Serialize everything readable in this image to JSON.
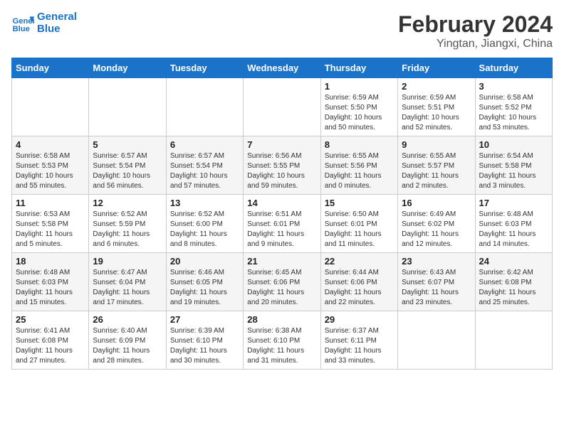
{
  "header": {
    "logo_line1": "General",
    "logo_line2": "Blue",
    "title": "February 2024",
    "subtitle": "Yingtan, Jiangxi, China"
  },
  "weekdays": [
    "Sunday",
    "Monday",
    "Tuesday",
    "Wednesday",
    "Thursday",
    "Friday",
    "Saturday"
  ],
  "weeks": [
    [
      {
        "day": "",
        "sunrise": "",
        "sunset": "",
        "daylight": ""
      },
      {
        "day": "",
        "sunrise": "",
        "sunset": "",
        "daylight": ""
      },
      {
        "day": "",
        "sunrise": "",
        "sunset": "",
        "daylight": ""
      },
      {
        "day": "",
        "sunrise": "",
        "sunset": "",
        "daylight": ""
      },
      {
        "day": "1",
        "sunrise": "Sunrise: 6:59 AM",
        "sunset": "Sunset: 5:50 PM",
        "daylight": "Daylight: 10 hours and 50 minutes."
      },
      {
        "day": "2",
        "sunrise": "Sunrise: 6:59 AM",
        "sunset": "Sunset: 5:51 PM",
        "daylight": "Daylight: 10 hours and 52 minutes."
      },
      {
        "day": "3",
        "sunrise": "Sunrise: 6:58 AM",
        "sunset": "Sunset: 5:52 PM",
        "daylight": "Daylight: 10 hours and 53 minutes."
      }
    ],
    [
      {
        "day": "4",
        "sunrise": "Sunrise: 6:58 AM",
        "sunset": "Sunset: 5:53 PM",
        "daylight": "Daylight: 10 hours and 55 minutes."
      },
      {
        "day": "5",
        "sunrise": "Sunrise: 6:57 AM",
        "sunset": "Sunset: 5:54 PM",
        "daylight": "Daylight: 10 hours and 56 minutes."
      },
      {
        "day": "6",
        "sunrise": "Sunrise: 6:57 AM",
        "sunset": "Sunset: 5:54 PM",
        "daylight": "Daylight: 10 hours and 57 minutes."
      },
      {
        "day": "7",
        "sunrise": "Sunrise: 6:56 AM",
        "sunset": "Sunset: 5:55 PM",
        "daylight": "Daylight: 10 hours and 59 minutes."
      },
      {
        "day": "8",
        "sunrise": "Sunrise: 6:55 AM",
        "sunset": "Sunset: 5:56 PM",
        "daylight": "Daylight: 11 hours and 0 minutes."
      },
      {
        "day": "9",
        "sunrise": "Sunrise: 6:55 AM",
        "sunset": "Sunset: 5:57 PM",
        "daylight": "Daylight: 11 hours and 2 minutes."
      },
      {
        "day": "10",
        "sunrise": "Sunrise: 6:54 AM",
        "sunset": "Sunset: 5:58 PM",
        "daylight": "Daylight: 11 hours and 3 minutes."
      }
    ],
    [
      {
        "day": "11",
        "sunrise": "Sunrise: 6:53 AM",
        "sunset": "Sunset: 5:58 PM",
        "daylight": "Daylight: 11 hours and 5 minutes."
      },
      {
        "day": "12",
        "sunrise": "Sunrise: 6:52 AM",
        "sunset": "Sunset: 5:59 PM",
        "daylight": "Daylight: 11 hours and 6 minutes."
      },
      {
        "day": "13",
        "sunrise": "Sunrise: 6:52 AM",
        "sunset": "Sunset: 6:00 PM",
        "daylight": "Daylight: 11 hours and 8 minutes."
      },
      {
        "day": "14",
        "sunrise": "Sunrise: 6:51 AM",
        "sunset": "Sunset: 6:01 PM",
        "daylight": "Daylight: 11 hours and 9 minutes."
      },
      {
        "day": "15",
        "sunrise": "Sunrise: 6:50 AM",
        "sunset": "Sunset: 6:01 PM",
        "daylight": "Daylight: 11 hours and 11 minutes."
      },
      {
        "day": "16",
        "sunrise": "Sunrise: 6:49 AM",
        "sunset": "Sunset: 6:02 PM",
        "daylight": "Daylight: 11 hours and 12 minutes."
      },
      {
        "day": "17",
        "sunrise": "Sunrise: 6:48 AM",
        "sunset": "Sunset: 6:03 PM",
        "daylight": "Daylight: 11 hours and 14 minutes."
      }
    ],
    [
      {
        "day": "18",
        "sunrise": "Sunrise: 6:48 AM",
        "sunset": "Sunset: 6:03 PM",
        "daylight": "Daylight: 11 hours and 15 minutes."
      },
      {
        "day": "19",
        "sunrise": "Sunrise: 6:47 AM",
        "sunset": "Sunset: 6:04 PM",
        "daylight": "Daylight: 11 hours and 17 minutes."
      },
      {
        "day": "20",
        "sunrise": "Sunrise: 6:46 AM",
        "sunset": "Sunset: 6:05 PM",
        "daylight": "Daylight: 11 hours and 19 minutes."
      },
      {
        "day": "21",
        "sunrise": "Sunrise: 6:45 AM",
        "sunset": "Sunset: 6:06 PM",
        "daylight": "Daylight: 11 hours and 20 minutes."
      },
      {
        "day": "22",
        "sunrise": "Sunrise: 6:44 AM",
        "sunset": "Sunset: 6:06 PM",
        "daylight": "Daylight: 11 hours and 22 minutes."
      },
      {
        "day": "23",
        "sunrise": "Sunrise: 6:43 AM",
        "sunset": "Sunset: 6:07 PM",
        "daylight": "Daylight: 11 hours and 23 minutes."
      },
      {
        "day": "24",
        "sunrise": "Sunrise: 6:42 AM",
        "sunset": "Sunset: 6:08 PM",
        "daylight": "Daylight: 11 hours and 25 minutes."
      }
    ],
    [
      {
        "day": "25",
        "sunrise": "Sunrise: 6:41 AM",
        "sunset": "Sunset: 6:08 PM",
        "daylight": "Daylight: 11 hours and 27 minutes."
      },
      {
        "day": "26",
        "sunrise": "Sunrise: 6:40 AM",
        "sunset": "Sunset: 6:09 PM",
        "daylight": "Daylight: 11 hours and 28 minutes."
      },
      {
        "day": "27",
        "sunrise": "Sunrise: 6:39 AM",
        "sunset": "Sunset: 6:10 PM",
        "daylight": "Daylight: 11 hours and 30 minutes."
      },
      {
        "day": "28",
        "sunrise": "Sunrise: 6:38 AM",
        "sunset": "Sunset: 6:10 PM",
        "daylight": "Daylight: 11 hours and 31 minutes."
      },
      {
        "day": "29",
        "sunrise": "Sunrise: 6:37 AM",
        "sunset": "Sunset: 6:11 PM",
        "daylight": "Daylight: 11 hours and 33 minutes."
      },
      {
        "day": "",
        "sunrise": "",
        "sunset": "",
        "daylight": ""
      },
      {
        "day": "",
        "sunrise": "",
        "sunset": "",
        "daylight": ""
      }
    ]
  ]
}
